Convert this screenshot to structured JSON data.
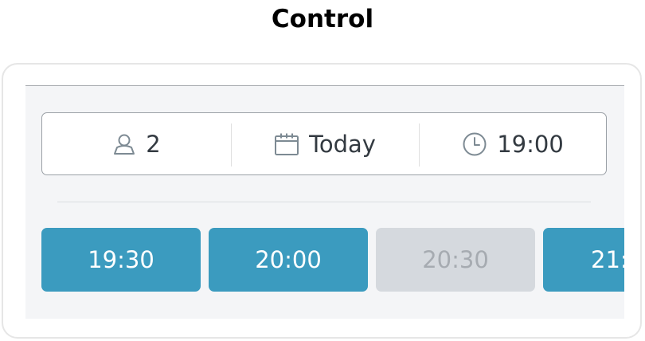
{
  "heading": "Control",
  "selector": {
    "guests": {
      "icon": "person-icon",
      "value": "2"
    },
    "date": {
      "icon": "calendar-icon",
      "value": "Today"
    },
    "time": {
      "icon": "clock-icon",
      "value": "19:00"
    }
  },
  "slots": [
    {
      "label": "19:30",
      "state": "available"
    },
    {
      "label": "20:00",
      "state": "available"
    },
    {
      "label": "20:30",
      "state": "unavailable"
    },
    {
      "label": "21:",
      "state": "available"
    }
  ],
  "colors": {
    "accent": "#3b9bbf",
    "disabled": "#d5d9de",
    "disabled_text": "#a6abb1",
    "icon": "#7d8a93"
  }
}
